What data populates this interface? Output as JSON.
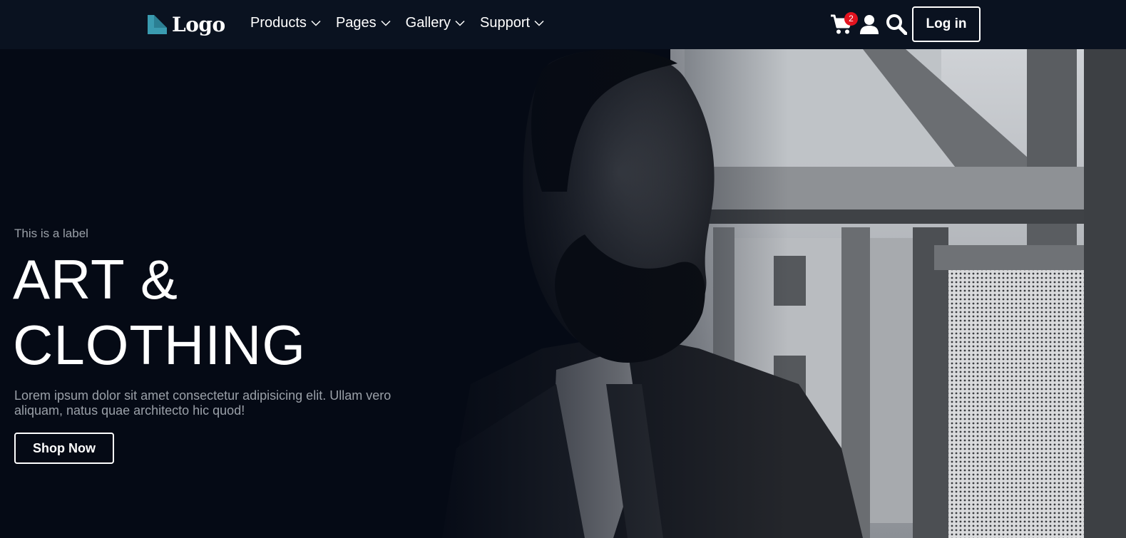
{
  "brand": {
    "logo_text": "Logo",
    "logo_color": "#3a9bb0"
  },
  "nav": {
    "items": [
      {
        "label": "Products",
        "icon": "chevron-down-icon"
      },
      {
        "label": "Pages",
        "icon": "chevron-down-icon"
      },
      {
        "label": "Gallery",
        "icon": "chevron-down-icon"
      },
      {
        "label": "Support",
        "icon": "chevron-down-icon"
      }
    ],
    "cart": {
      "icon": "cart-icon",
      "count": "2",
      "badge_color": "#e3131f"
    },
    "user_icon": "user-icon",
    "search_icon": "search-icon",
    "login_label": "Log in"
  },
  "hero": {
    "label": "This is a label",
    "title_line1": "ART &",
    "title_line2": "CLOTHING",
    "description": "Lorem ipsum dolor sit amet consectetur adipisicing elit. Ullam vero aliquam, natus quae architecto hic quod!",
    "cta_label": "Shop Now",
    "image": "black-and-white portrait photo of a bearded man in a suit looking out a window"
  },
  "colors": {
    "nav_bg": "#0a1220",
    "hero_bg": "#050a15",
    "text_muted": "#9aa0a8"
  }
}
